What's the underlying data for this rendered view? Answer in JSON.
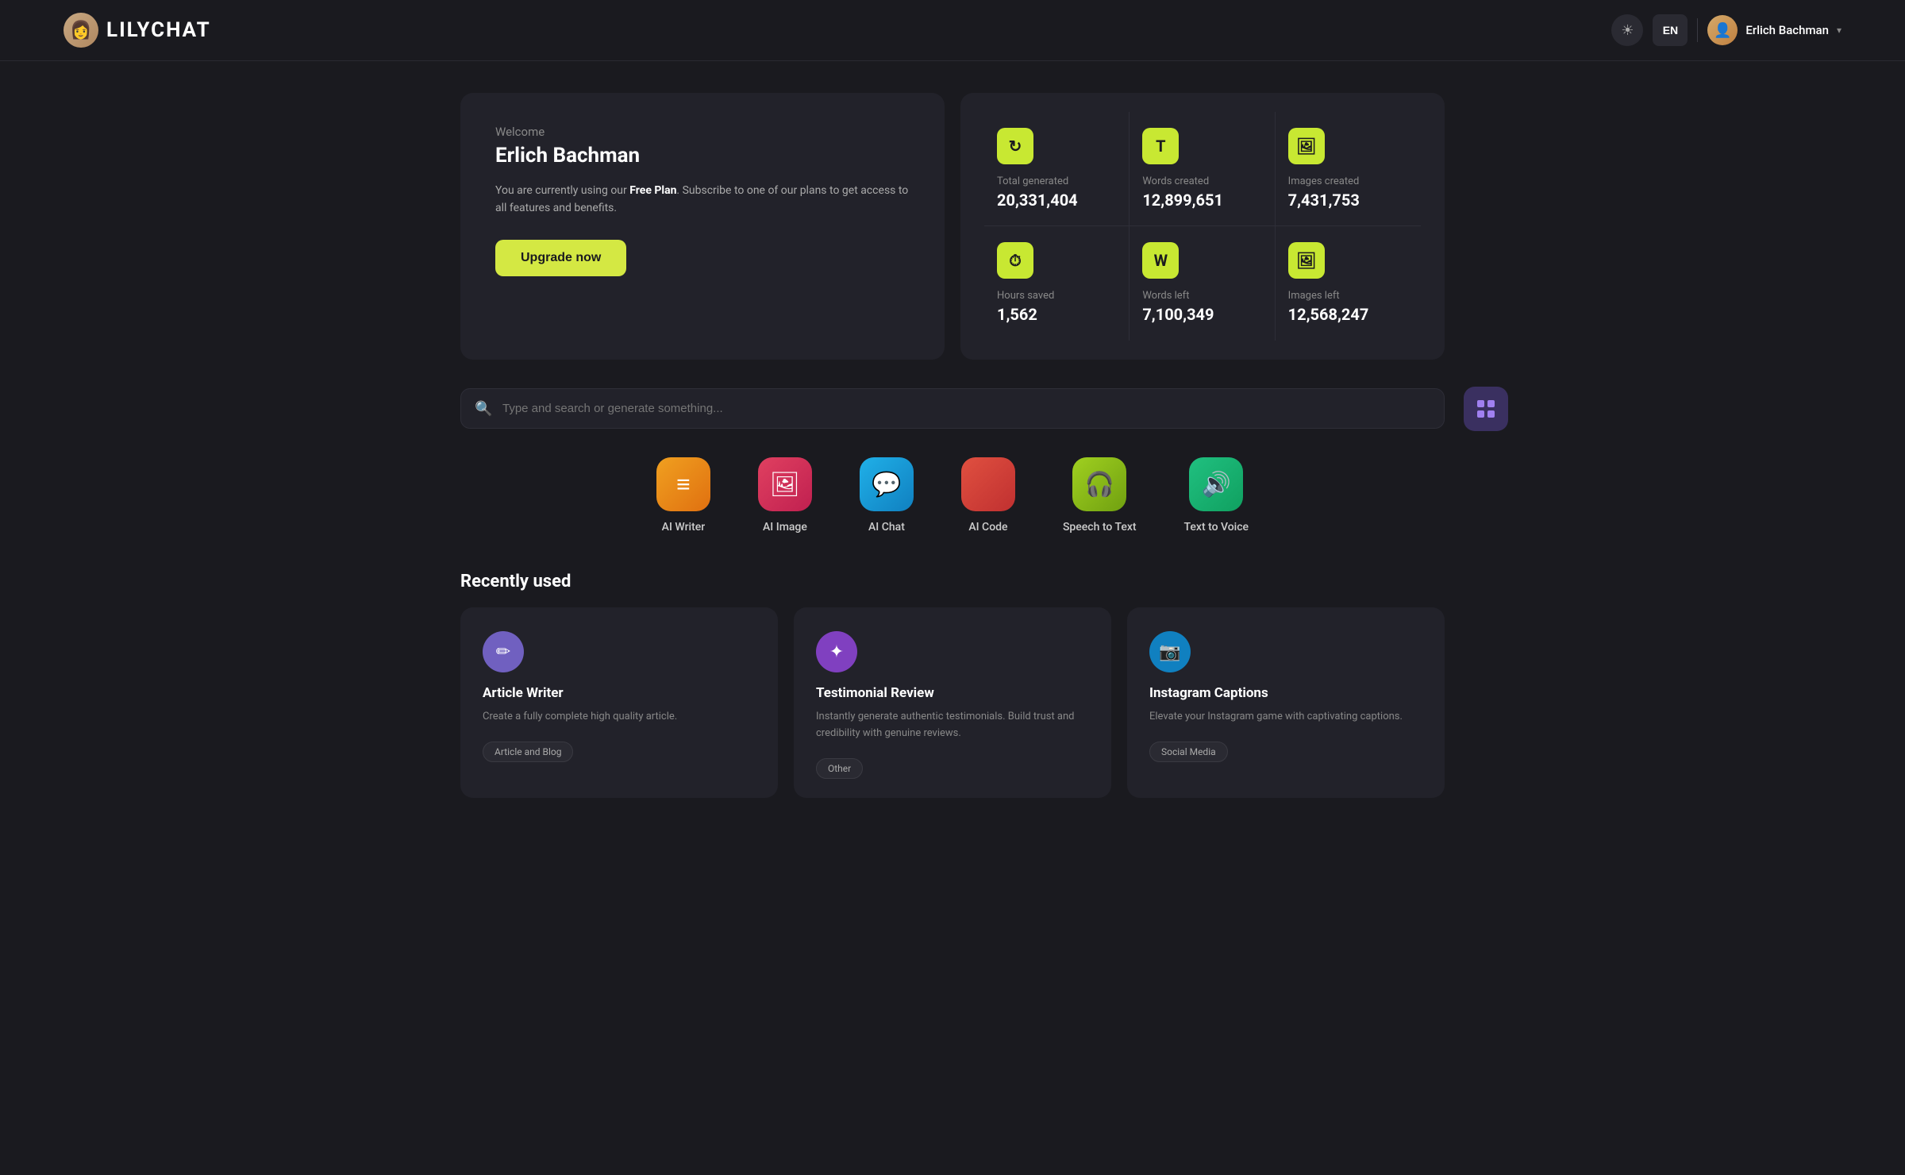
{
  "header": {
    "logo_text": "LILYCHAT",
    "logo_emoji": "👩",
    "lang_label": "EN",
    "user_name": "Erlich Bachman",
    "user_emoji": "👤",
    "theme_icon": "☀"
  },
  "welcome_card": {
    "label": "Welcome",
    "name": "Erlich Bachman",
    "desc_prefix": "You are currently using our ",
    "plan": "Free Plan",
    "desc_suffix": ". Subscribe to one of our plans to get access to all features and benefits.",
    "upgrade_label": "Upgrade now"
  },
  "stats": [
    {
      "icon": "↻",
      "label": "Total generated",
      "value": "20,331,404"
    },
    {
      "icon": "T",
      "label": "Words created",
      "value": "12,899,651"
    },
    {
      "icon": "🖼",
      "label": "Images created",
      "value": "7,431,753"
    },
    {
      "icon": "⏱",
      "label": "Hours saved",
      "value": "1,562"
    },
    {
      "icon": "W",
      "label": "Words left",
      "value": "7,100,349"
    },
    {
      "icon": "🖼",
      "label": "Images left",
      "value": "12,568,247"
    }
  ],
  "search": {
    "placeholder": "Type and search or generate something..."
  },
  "features": [
    {
      "id": "ai-writer",
      "label": "AI Writer",
      "icon": "≡",
      "color_class": "fi-writer"
    },
    {
      "id": "ai-image",
      "label": "AI Image",
      "icon": "🖼",
      "color_class": "fi-image"
    },
    {
      "id": "ai-chat",
      "label": "AI Chat",
      "icon": "💬",
      "color_class": "fi-chat"
    },
    {
      "id": "ai-code",
      "label": "AI Code",
      "icon": "</>",
      "color_class": "fi-code"
    },
    {
      "id": "speech-to-text",
      "label": "Speech to Text",
      "icon": "🎧",
      "color_class": "fi-speech"
    },
    {
      "id": "text-to-voice",
      "label": "Text to Voice",
      "icon": "🔊",
      "color_class": "fi-voice"
    }
  ],
  "recently_used": {
    "title": "Recently used",
    "cards": [
      {
        "id": "article-writer",
        "icon": "✏",
        "icon_class": "rci-purple",
        "title": "Article Writer",
        "desc": "Create a fully complete high quality article.",
        "tag": "Article and Blog"
      },
      {
        "id": "testimonial-review",
        "icon": "✦",
        "icon_class": "rci-violet",
        "title": "Testimonial Review",
        "desc": "Instantly generate authentic testimonials. Build trust and credibility with genuine reviews.",
        "tag": "Other"
      },
      {
        "id": "instagram-captions",
        "icon": "📷",
        "icon_class": "rci-blue",
        "title": "Instagram Captions",
        "desc": "Elevate your Instagram game with captivating captions.",
        "tag": "Social Media"
      }
    ]
  }
}
